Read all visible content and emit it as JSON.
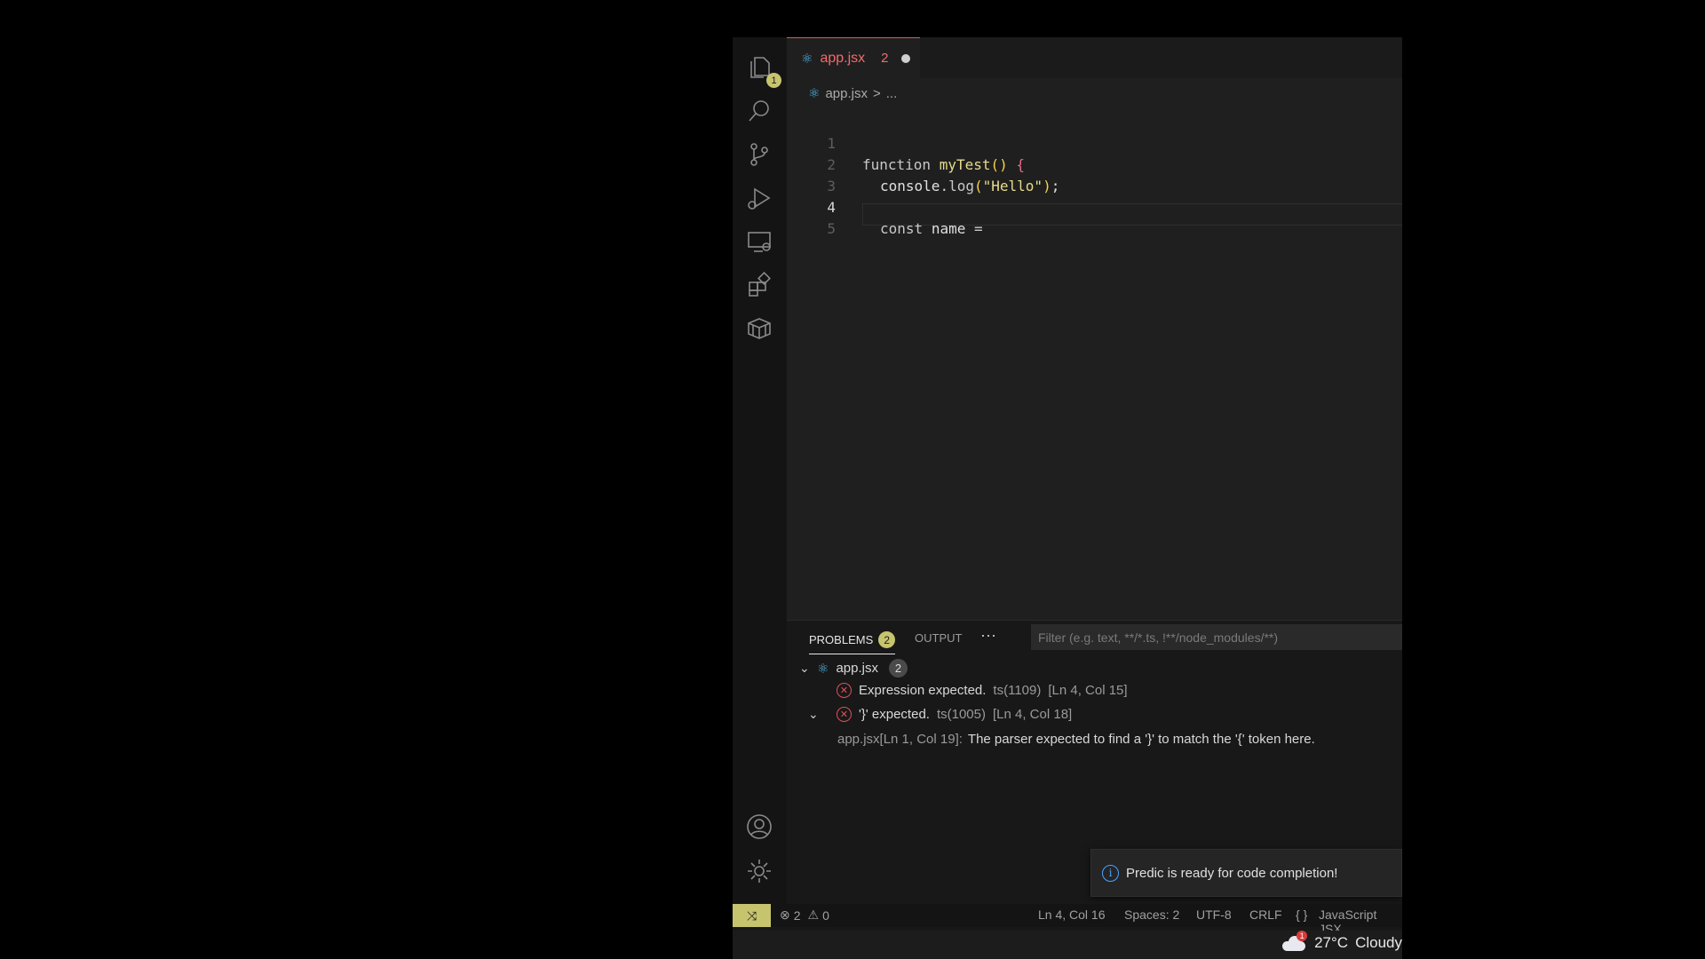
{
  "activity_bar": {
    "explorer_badge": "1",
    "items": [
      "explorer-icon",
      "search-icon",
      "source-control-icon",
      "run-debug-icon",
      "remote-explorer-icon",
      "extensions-icon",
      "containers-icon"
    ],
    "bottom_items": [
      "account-icon",
      "settings-gear-icon"
    ]
  },
  "tab": {
    "label": "app.jsx",
    "problem_count": "2"
  },
  "breadcrumb": {
    "file": "app.jsx",
    "separator": ">",
    "rest": "..."
  },
  "editor": {
    "active_line": 4,
    "lines": [
      {
        "num": "1",
        "parts": [
          "function",
          " ",
          "myTest",
          "()",
          " ",
          "{"
        ]
      },
      {
        "num": "2",
        "parts": [
          "console",
          ".",
          "log",
          "(",
          "\"Hello\"",
          ")",
          ";"
        ]
      },
      {
        "num": "3",
        "parts": []
      },
      {
        "num": "4",
        "parts": [
          "const",
          " ",
          "name",
          " ",
          "="
        ]
      },
      {
        "num": "5",
        "parts": []
      }
    ]
  },
  "panel": {
    "tabs": {
      "problems": "PROBLEMS",
      "problems_count": "2",
      "output": "OUTPUT",
      "more": "···"
    },
    "filter_placeholder": "Filter (e.g. text, **/*.ts, !**/node_modules/**)",
    "file_group": {
      "file": "app.jsx",
      "count": "2"
    },
    "problems": [
      {
        "message": "Expression expected.",
        "code": "ts(1109)",
        "location": "[Ln 4, Col 15]"
      },
      {
        "message": "'}' expected.",
        "code": "ts(1005)",
        "location": "[Ln 4, Col 18]"
      }
    ],
    "related": {
      "source": "app.jsx[Ln 1, Col 19]:",
      "text": "The parser expected to find a '}' to match the '{' token here."
    }
  },
  "toast": {
    "message": "Predic is ready for code completion!"
  },
  "status_bar": {
    "errors": "2",
    "warnings": "0",
    "position": "Ln 4, Col 16",
    "spaces": "Spaces: 2",
    "encoding": "UTF-8",
    "eol": "CRLF",
    "language_icon": "{ }",
    "language": "JavaScript JSX"
  },
  "taskbar": {
    "weather_badge": "1",
    "temperature": "27°C",
    "condition": "Cloudy"
  },
  "colors": {
    "accent": "#c7c46e",
    "error": "#e0505a",
    "tab_active_text": "#f16b6e",
    "react_icon": "#53b5e6"
  }
}
